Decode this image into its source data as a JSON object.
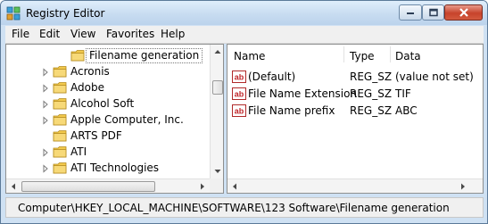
{
  "window": {
    "title": "Registry Editor"
  },
  "menu": {
    "items": [
      "File",
      "Edit",
      "View",
      "Favorites",
      "Help"
    ]
  },
  "tree": {
    "selected": "Filename generation",
    "items": [
      "Acronis",
      "Adobe",
      "Alcohol Soft",
      "Apple Computer, Inc.",
      "ARTS PDF",
      "ATI",
      "ATI Technologies"
    ]
  },
  "values": {
    "columns": {
      "name": "Name",
      "type": "Type",
      "data": "Data"
    },
    "rows": [
      {
        "name": "(Default)",
        "type": "REG_SZ",
        "data": "(value not set)"
      },
      {
        "name": "File Name Extension",
        "type": "REG_SZ",
        "data": "TIF"
      },
      {
        "name": "File Name prefix",
        "type": "REG_SZ",
        "data": "ABC"
      }
    ]
  },
  "status": {
    "path": "Computer\\HKEY_LOCAL_MACHINE\\SOFTWARE\\123 Software\\Filename generation"
  },
  "icons": {
    "app": "registry-editor-icon",
    "folder": "folder-icon",
    "value": "reg-sz-icon",
    "expand": "expand-arrow-icon"
  },
  "colors": {
    "title_bar": "#c8dcf1",
    "close_button": "#c7432b",
    "folder": "#f2c94c"
  }
}
